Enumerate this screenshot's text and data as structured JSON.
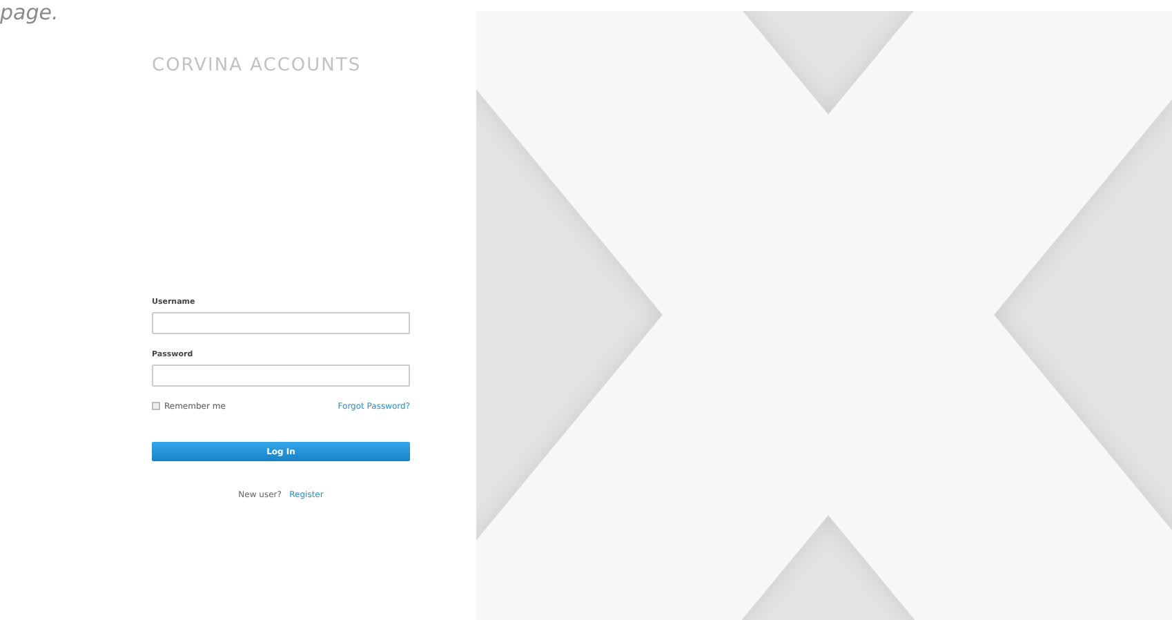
{
  "caption_fragment": "page.",
  "brand": "CORVINA ACCOUNTS",
  "form": {
    "fields": [
      {
        "label": "Username"
      },
      {
        "label": "Password"
      }
    ],
    "remember": {
      "label": "Remember me",
      "checked": false
    },
    "forgot_link": "Forgot Password?",
    "submit": "Log In",
    "signup_prompt": "New user?",
    "signup_link": "Register"
  }
}
